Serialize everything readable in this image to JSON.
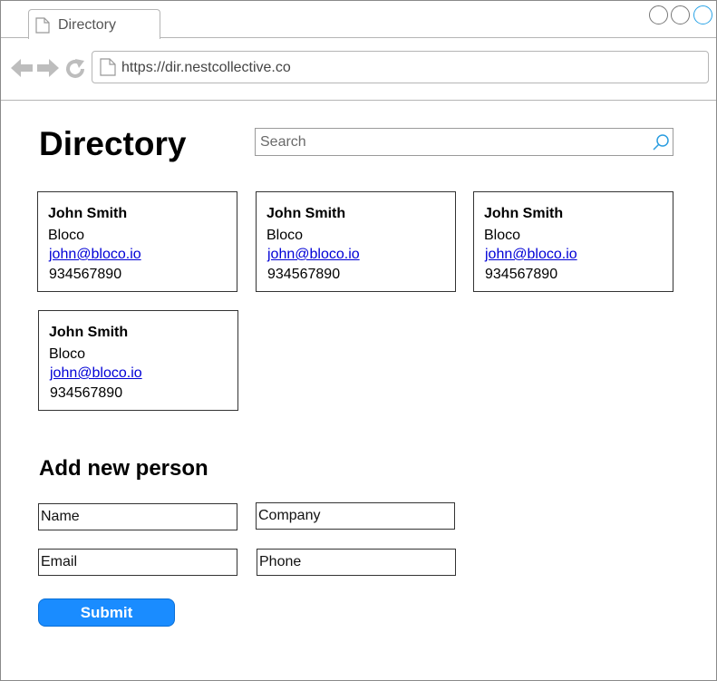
{
  "browser": {
    "tab_title": "Directory",
    "url": "https://dir.nestcollective.co"
  },
  "header": {
    "title": "Directory",
    "search_placeholder": "Search"
  },
  "people": [
    {
      "name": "John Smith",
      "company": "Bloco",
      "email": "john@bloco.io",
      "phone": "934567890"
    },
    {
      "name": "John Smith",
      "company": "Bloco",
      "email": "john@bloco.io",
      "phone": "934567890"
    },
    {
      "name": "John Smith",
      "company": "Bloco",
      "email": "john@bloco.io",
      "phone": "934567890"
    },
    {
      "name": "John Smith",
      "company": "Bloco",
      "email": "john@bloco.io",
      "phone": "934567890"
    }
  ],
  "form": {
    "title": "Add new person",
    "name_placeholder": "Name",
    "company_placeholder": "Company",
    "email_placeholder": "Email",
    "phone_placeholder": "Phone",
    "submit_label": "Submit"
  },
  "colors": {
    "accent": "#1a8cff",
    "link": "#0000d6",
    "close_button": "#2aa3e6"
  }
}
